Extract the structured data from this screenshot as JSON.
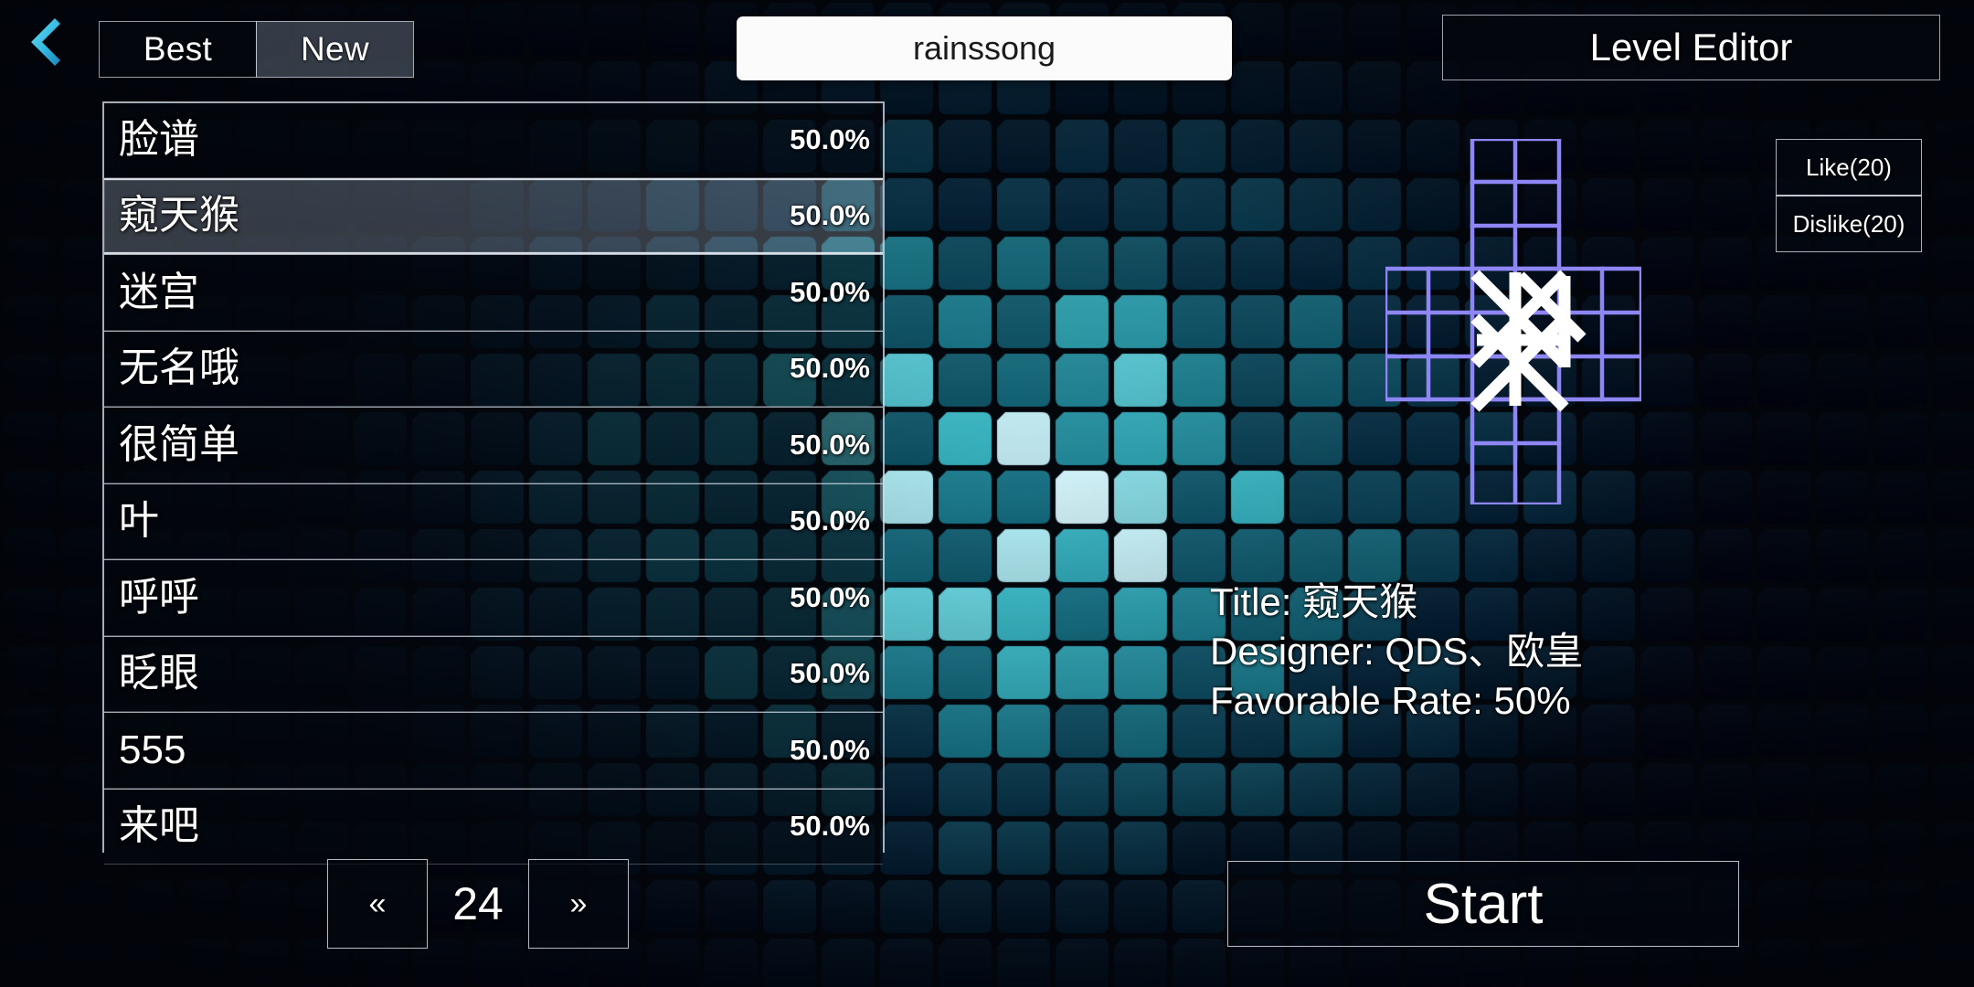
{
  "colors": {
    "accent_cyan": "#3fc6e8",
    "preview_grid": "#8f86f5",
    "preview_lines": "#ffffff",
    "panel_border": "#d0d8e2",
    "search_bg": "#fbfbfb",
    "bg_dark": "#04070c"
  },
  "topbar": {
    "back_icon": "back-chevron-icon",
    "tabs": [
      {
        "label": "Best",
        "active": false
      },
      {
        "label": "New",
        "active": true
      }
    ],
    "search": {
      "value": "rainssong",
      "placeholder": "rainssong"
    },
    "level_editor_label": "Level Editor"
  },
  "level_list": {
    "rows": [
      {
        "name": "脸谱",
        "rate": "50.0%",
        "selected": false
      },
      {
        "name": "窥天猴",
        "rate": "50.0%",
        "selected": true
      },
      {
        "name": "迷宫",
        "rate": "50.0%",
        "selected": false
      },
      {
        "name": "无名哦",
        "rate": "50.0%",
        "selected": false
      },
      {
        "name": "很简单",
        "rate": "50.0%",
        "selected": false
      },
      {
        "name": "叶",
        "rate": "50.0%",
        "selected": false
      },
      {
        "name": "呼呼",
        "rate": "50.0%",
        "selected": false
      },
      {
        "name": "眨眼",
        "rate": "50.0%",
        "selected": false
      },
      {
        "name": "555",
        "rate": "50.0%",
        "selected": false
      },
      {
        "name": "来吧",
        "rate": "50.0%",
        "selected": false
      }
    ]
  },
  "pagination": {
    "prev_label": "«",
    "page_number": "24",
    "next_label": "»"
  },
  "vote": {
    "like_label": "Like(20)",
    "dislike_label": "Dislike(20)"
  },
  "preview": {
    "name": "level-preview-grid",
    "shape": "plus-cross"
  },
  "info": {
    "title_line": "Title: 窥天猴",
    "designer_line": "Designer: QDS、欧皇",
    "rate_line": "Favorable Rate: 50%"
  },
  "start": {
    "label": "Start"
  }
}
